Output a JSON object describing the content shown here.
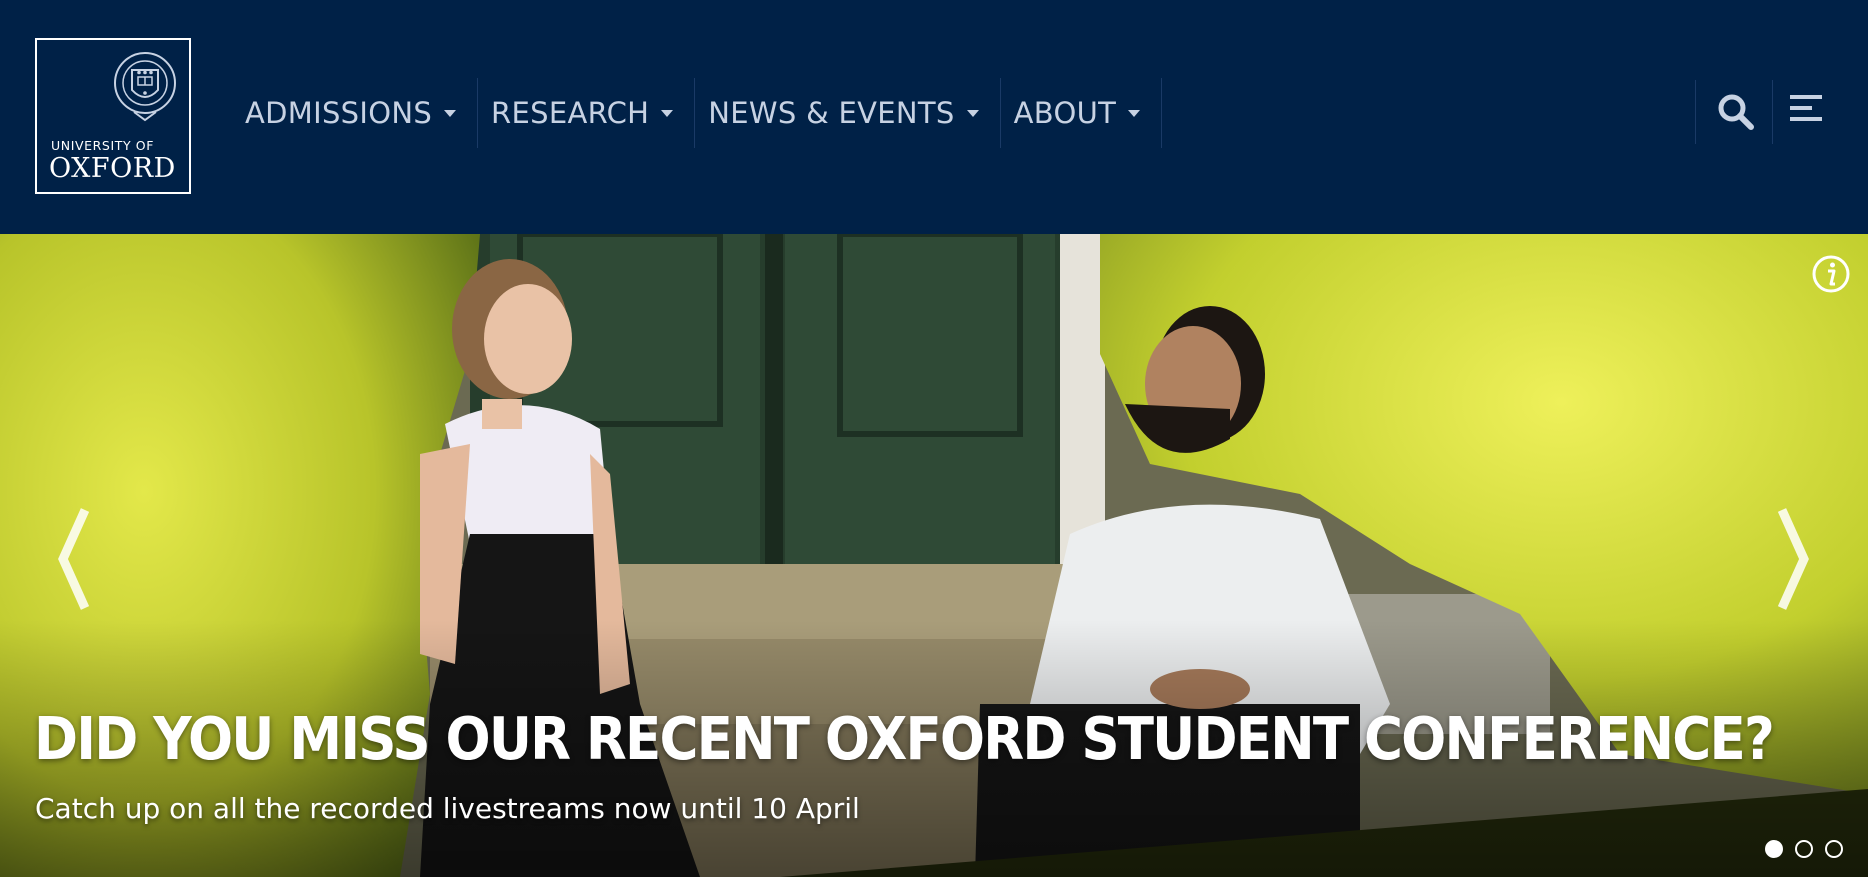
{
  "logo": {
    "line1": "UNIVERSITY OF",
    "line2": "OXFORD",
    "icon": "crest-icon"
  },
  "nav": {
    "items": [
      {
        "label": "ADMISSIONS",
        "icon": "caret-down-icon"
      },
      {
        "label": "RESEARCH",
        "icon": "caret-down-icon"
      },
      {
        "label": "NEWS & EVENTS",
        "icon": "caret-down-icon"
      },
      {
        "label": "ABOUT",
        "icon": "caret-down-icon"
      }
    ]
  },
  "header_actions": {
    "search_icon": "search-icon",
    "menu_icon": "hamburger-menu-icon"
  },
  "hero": {
    "title": "DID YOU MISS OUR RECENT OXFORD STUDENT CONFERENCE?",
    "subtitle": "Catch up on all the recorded livestreams now until 10 April",
    "info_icon": "info-icon",
    "prev_icon": "chevron-left-icon",
    "next_icon": "chevron-right-icon",
    "slides": 3,
    "active_slide": 1
  },
  "colors": {
    "brand_navy": "#002147",
    "nav_text": "#c7d2e3",
    "foliage": "#c6d33a",
    "door_green": "#2d4a35"
  }
}
